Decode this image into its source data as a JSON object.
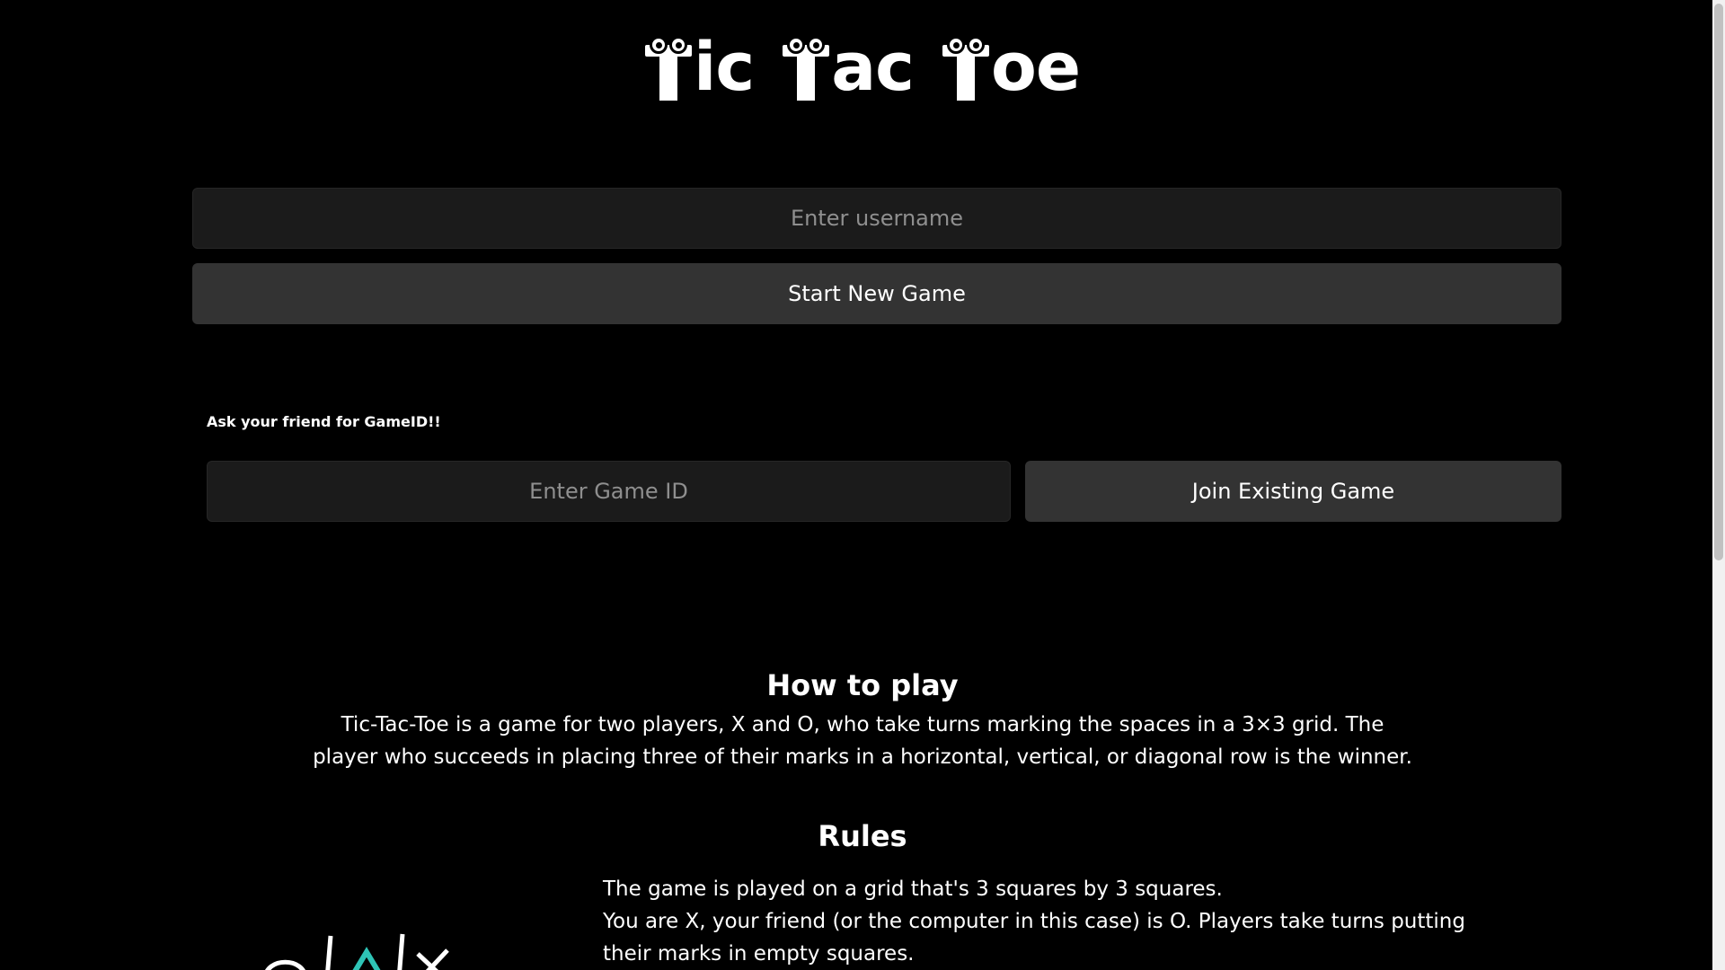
{
  "title": {
    "words": [
      {
        "first": "T",
        "rest": "ic"
      },
      {
        "first": "T",
        "rest": "ac"
      },
      {
        "first": "T",
        "rest": "oe"
      }
    ]
  },
  "username_input": {
    "placeholder": "Enter username",
    "value": ""
  },
  "start_button": {
    "label": "Start New Game"
  },
  "join_hint": "Ask your friend for GameID!!",
  "gameid_input": {
    "placeholder": "Enter Game ID",
    "value": ""
  },
  "join_button": {
    "label": "Join Existing Game"
  },
  "how_to_play": {
    "heading": "How to play",
    "text": "Tic-Tac-Toe is a game for two players, X and O, who take turns marking the spaces in a 3×3 grid. The player who succeeds in placing three of their marks in a horizontal, vertical, or diagonal row is the winner."
  },
  "rules": {
    "heading": "Rules",
    "items": [
      "The game is played on a grid that's 3 squares by 3 squares.",
      "You are X, your friend (or the computer in this case) is O. Players take turns putting their marks in empty squares."
    ]
  },
  "colors": {
    "background": "#000000",
    "input_bg": "#1b1b1b",
    "button_bg": "#333333",
    "accent_teal": "#2ec4b6"
  }
}
